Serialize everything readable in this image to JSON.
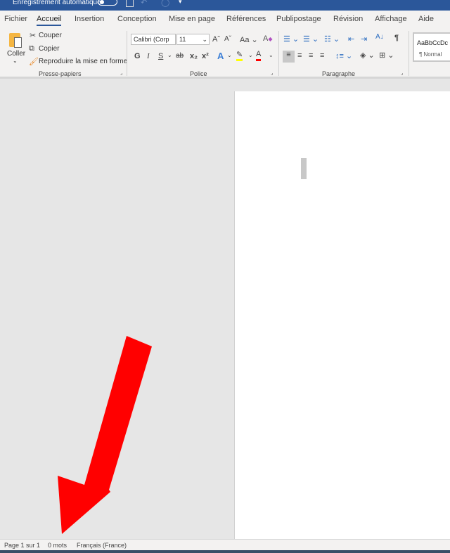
{
  "titlebar": {
    "autosave_label": "Enregistrement automatique",
    "save_icon": "save-icon",
    "undo_icon": "undo-icon",
    "redo_icon": "redo-icon",
    "customize_icon": "chevron-down-icon"
  },
  "tabs": [
    "Fichier",
    "Accueil",
    "Insertion",
    "Conception",
    "Mise en page",
    "Références",
    "Publipostage",
    "Révision",
    "Affichage",
    "Aide"
  ],
  "active_tab": "Accueil",
  "clipboard": {
    "paste": "Coller",
    "cut": "Couper",
    "copy": "Copier",
    "format_painter": "Reproduire la mise en forme",
    "group": "Presse-papiers"
  },
  "font": {
    "name": "Calibri (Corp",
    "size": "11",
    "group": "Police",
    "bold": "G",
    "italic": "I",
    "underline": "S",
    "strike": "ab",
    "subscript": "x₂",
    "superscript": "x²",
    "case": "Aa",
    "highlight_color": "#ffff00",
    "font_color": "#ff0000"
  },
  "paragraph": {
    "group": "Paragraphe",
    "pilcrow": "¶"
  },
  "styles": {
    "preview": "AaBbCcDc",
    "normal": "¶ Normal"
  },
  "status": {
    "page": "Page 1 sur 1",
    "words": "0 mots",
    "language": "Français (France)"
  },
  "colors": {
    "accent": "#2b579a",
    "arrow": "#ff0000"
  }
}
